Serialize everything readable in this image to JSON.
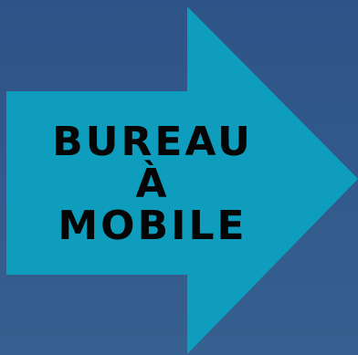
{
  "graphic": {
    "line1": "BUREAU",
    "line2": "À",
    "line3": "MOBILE",
    "arrow_color": "#0f9dbd",
    "text_color": "#050505",
    "background_top": "#2e5388",
    "background_bottom": "#36608f",
    "icon": "right-arrow-icon"
  }
}
